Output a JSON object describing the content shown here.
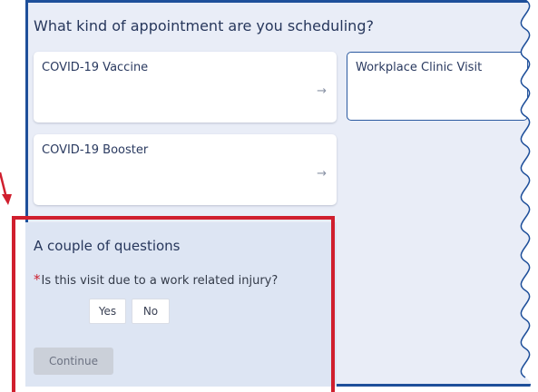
{
  "page": {
    "heading": "What kind of appointment are you scheduling?"
  },
  "appointment_types": [
    {
      "label": "COVID-19 Vaccine",
      "arrow": "→"
    },
    {
      "label": "COVID-19 Booster",
      "arrow": "→"
    },
    {
      "label": "Workplace Clinic Visit"
    }
  ],
  "questions": {
    "title": "A couple of questions",
    "required_marker": "*",
    "question": "Is this visit due to a work related injury?",
    "yes_label": "Yes",
    "no_label": "No",
    "continue_label": "Continue"
  },
  "colors": {
    "panel_border": "#1e4f9a",
    "panel_background": "#e9edf7",
    "annotation": "#d01f2e",
    "continue_disabled": "#cbd0d9"
  }
}
